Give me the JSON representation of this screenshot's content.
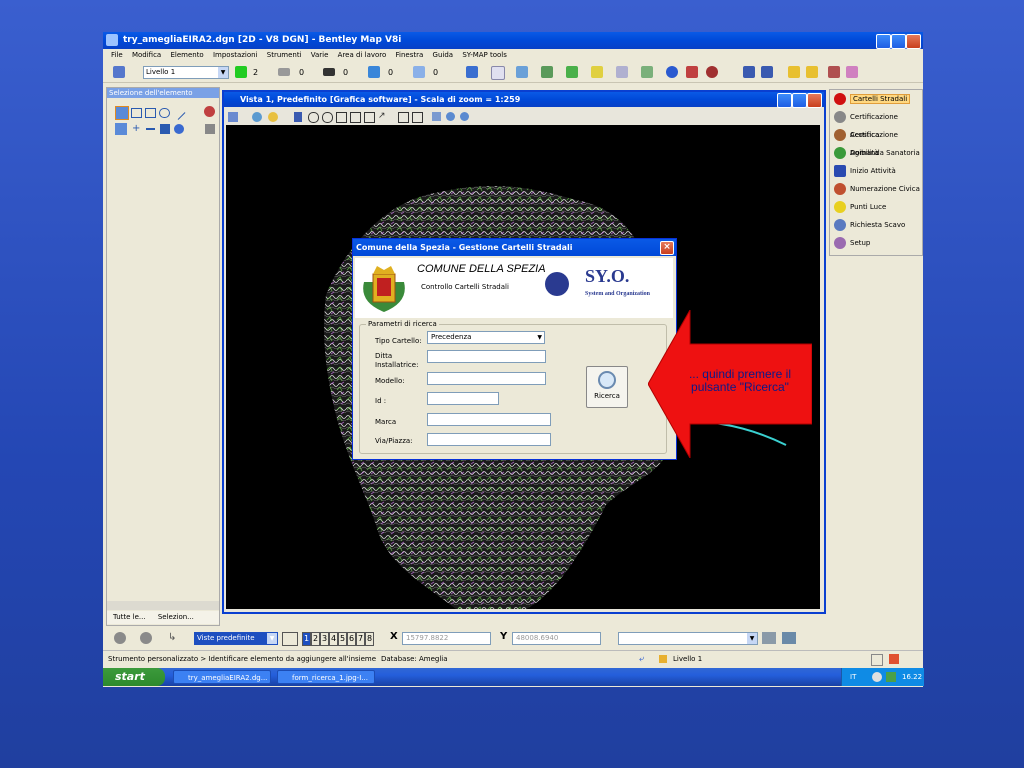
{
  "app": {
    "title": "try_amegliaEIRA2.dgn [2D - V8 DGN] - Bentley Map V8i",
    "menu": [
      "File",
      "Modifica",
      "Elemento",
      "Impostazioni",
      "Strumenti",
      "Varie",
      "Area di lavoro",
      "Finestra",
      "Guida",
      "SY-MAP tools"
    ],
    "level_combo": "Livello 1",
    "combo_values": [
      "2",
      "0",
      "0",
      "0",
      "0"
    ]
  },
  "left_panel": {
    "title": "Selezione dell'elemento",
    "tabs": [
      "Tutte le...",
      "Selezion..."
    ]
  },
  "view": {
    "title": "Vista 1, Predefinito [Grafica software] - Scala di zoom = 1:259"
  },
  "right_panel": {
    "items": [
      {
        "label": "Cartelli Stradali",
        "selected": true,
        "color": "#d01010"
      },
      {
        "label": "Certificazione Acustica",
        "color": "#888"
      },
      {
        "label": "Certificazione Agibilità",
        "color": "#a06030"
      },
      {
        "label": "Domanda Sanatoria",
        "color": "#3a9a3a"
      },
      {
        "label": "Inizio Attività",
        "color": "#2a4ab0"
      },
      {
        "label": "Numerazione Civica",
        "color": "#c05030"
      },
      {
        "label": "Punti Luce",
        "color": "#e8d020"
      },
      {
        "label": "Richiesta Scavo",
        "color": "#5a7ac0"
      },
      {
        "label": "Setup",
        "color": "#9a6ab0"
      }
    ]
  },
  "dialog": {
    "title": "Comune della Spezia - Gestione Cartelli Stradali",
    "header_title": "COMUNE DELLA SPEZIA",
    "header_sub": "Controllo Cartelli Stradali",
    "logo_text": "SY.O.",
    "logo_sub": "System and Organization",
    "group_label": "Parametri di ricerca",
    "tipo_label": "Tipo Cartello:",
    "tipo_value": "Precedenza",
    "ditta_label": "Ditta Installatrice:",
    "modello_label": "Modello:",
    "id_label": "Id :",
    "marca_label": "Marca",
    "via_label": "Via/Piazza:",
    "search_button": "Ricerca"
  },
  "callout": {
    "text": "... quindi premere il pulsante \"Ricerca\""
  },
  "view_bar": {
    "views_combo": "Viste predefinite",
    "view_numbers": [
      "1",
      "2",
      "3",
      "4",
      "5",
      "6",
      "7",
      "8"
    ],
    "x_label": "X",
    "x_value": "15797.8822",
    "y_label": "Y",
    "y_value": "48008.6940"
  },
  "status": {
    "message": "Strumento personalizzato > Identificare elemento da aggiungere all'insieme",
    "database": "Database: Ameglia",
    "level": "Livello 1"
  },
  "taskbar": {
    "start": "start",
    "tasks": [
      "try_amegliaEIRA2.dg...",
      "form_ricerca_1.jpg-I..."
    ],
    "lang": "IT",
    "clock": "16.22"
  }
}
